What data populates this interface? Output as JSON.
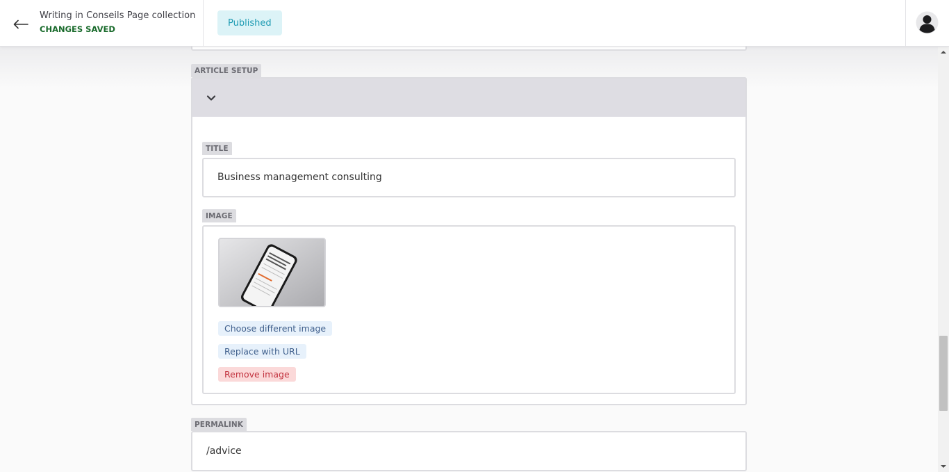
{
  "header": {
    "doc_title": "Writing in Conseils Page collection",
    "save_status": "CHANGES SAVED",
    "status_label": "Published",
    "back_icon": "arrow-left-icon",
    "avatar_icon": "user-avatar-icon"
  },
  "article_setup": {
    "section_label": "ARTICLE SETUP",
    "toggle_icon": "chevron-down-icon",
    "title_field": {
      "label": "TITLE",
      "value": "Business management consulting"
    },
    "image_field": {
      "label": "IMAGE",
      "thumbnail": "phone-article-thumbnail",
      "choose_label": "Choose different image",
      "replace_label": "Replace with URL",
      "remove_label": "Remove image"
    }
  },
  "permalink": {
    "label": "PERMALINK",
    "value": "/advice"
  },
  "colors": {
    "status_bg": "#dcf3f7",
    "status_text": "#1e9bb3",
    "saved": "#1a6b2c",
    "remove": "#c2333f"
  }
}
